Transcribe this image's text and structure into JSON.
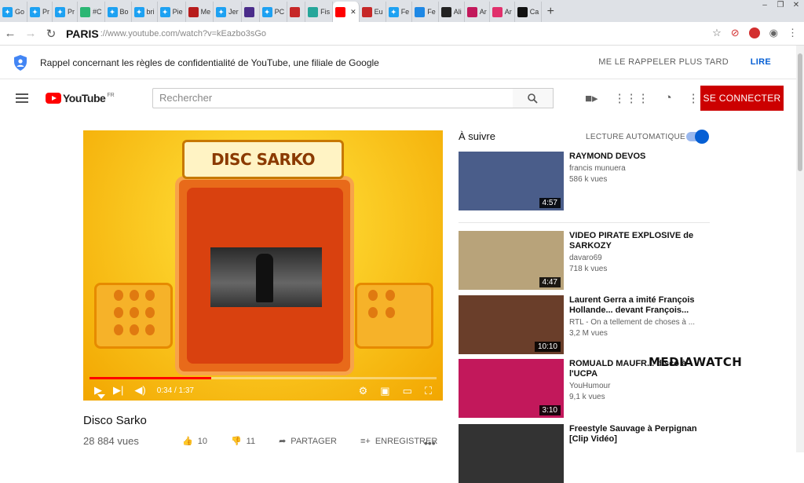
{
  "browser": {
    "tabs": [
      {
        "label": "Go",
        "icon": "twitter-icon",
        "color": "#1da1f2"
      },
      {
        "label": "Pr",
        "icon": "twitter-icon",
        "color": "#1da1f2"
      },
      {
        "label": "Pr",
        "icon": "twitter-icon",
        "color": "#1da1f2"
      },
      {
        "label": "#C",
        "icon": "bookmark-icon",
        "color": "#2bb673"
      },
      {
        "label": "Bo",
        "icon": "twitter-icon",
        "color": "#1da1f2"
      },
      {
        "label": "bri",
        "icon": "twitter-icon",
        "color": "#1da1f2"
      },
      {
        "label": "Pie",
        "icon": "twitter-icon",
        "color": "#1da1f2"
      },
      {
        "label": "Me",
        "icon": "p-icon",
        "color": "#b71c1c"
      },
      {
        "label": "Jer",
        "icon": "twitter-icon",
        "color": "#1da1f2"
      },
      {
        "label": "",
        "icon": "media-icon",
        "color": "#4a2c8a"
      },
      {
        "label": "PC",
        "icon": "twitter-icon",
        "color": "#1da1f2"
      },
      {
        "label": "",
        "icon": "grid-icon",
        "color": "#c62828"
      },
      {
        "label": "Fis",
        "icon": "link-icon",
        "color": "#26a69a"
      },
      {
        "label": "",
        "icon": "youtube-icon",
        "color": "#ff0000"
      },
      {
        "label": "Eu",
        "icon": "a-icon",
        "color": "#c62828"
      },
      {
        "label": "Fe",
        "icon": "twitter-icon",
        "color": "#1da1f2"
      },
      {
        "label": "Fe",
        "icon": "flag-icon",
        "color": "#1e88e5"
      },
      {
        "label": "Ali",
        "icon": "t-icon",
        "color": "#222222"
      },
      {
        "label": "Ar",
        "icon": "v-icon",
        "color": "#c2185b"
      },
      {
        "label": "Ar",
        "icon": "instagram-icon",
        "color": "#e1306c"
      },
      {
        "label": "Ca",
        "icon": "d-icon",
        "color": "#111111"
      }
    ],
    "address_label": "PARIS",
    "url": "://www.youtube.com/watch?v=kEazbo3sGo"
  },
  "privacy": {
    "text": "Rappel concernant les règles de confidentialité de YouTube, une filiale de Google",
    "remind_later": "ME LE RAPPELER PLUS TARD",
    "read": "LIRE"
  },
  "header": {
    "logo_text": "YouTube",
    "region": "FR",
    "search_placeholder": "Rechercher",
    "signin": "SE CONNECTER"
  },
  "player": {
    "sign_text": "DISC SARKO",
    "time": "0:34 / 1:37",
    "progress": 0.35
  },
  "video": {
    "title": "Disco Sarko",
    "views": "28 884 vues",
    "likes": "10",
    "dislikes": "11",
    "share": "PARTAGER",
    "save": "ENREGISTRER"
  },
  "sidebar": {
    "up_next": "À suivre",
    "autoplay": "LECTURE AUTOMATIQUE",
    "items": [
      {
        "title": "RAYMOND DEVOS",
        "channel": "francis munuera",
        "views": "586 k vues",
        "duration": "4:57",
        "thumb": "#4a5d8a"
      },
      {
        "title": "VIDEO PIRATE EXPLOSIVE de SARKOZY",
        "channel": "davaro69",
        "views": "718 k vues",
        "duration": "4:47",
        "thumb": "#b8a37a"
      },
      {
        "title": "Laurent Gerra a imité François Hollande... devant François...",
        "channel": "RTL - On a tellement de choses à ...",
        "views": "3,2 M vues",
        "duration": "10:10",
        "thumb": "#6a3e2a"
      },
      {
        "title": "ROMUALD MAUFR... disco à l'UCPA",
        "channel": "YouHumour",
        "views": "9,1 k vues",
        "duration": "3:10",
        "thumb": "#c2185b"
      },
      {
        "title": "Freestyle Sauvage à Perpignan [Clip Vidéo]",
        "channel": "",
        "views": "",
        "duration": "",
        "thumb": "#333333"
      }
    ]
  },
  "overlay": {
    "watermark": "MEDIAWATCH"
  }
}
